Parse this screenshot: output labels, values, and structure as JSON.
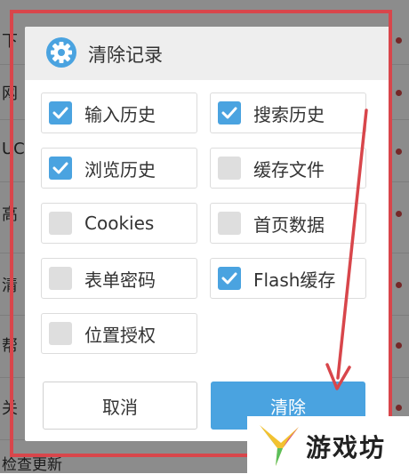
{
  "background": {
    "rows": [
      "下",
      "网",
      "UC",
      "高",
      "清",
      "帮",
      "关"
    ],
    "bottom_text": "检查更新"
  },
  "dialog": {
    "icon": "gear-icon",
    "title": "清除记录",
    "options": [
      {
        "label": "输入历史",
        "checked": true
      },
      {
        "label": "搜索历史",
        "checked": true
      },
      {
        "label": "浏览历史",
        "checked": true
      },
      {
        "label": "缓存文件",
        "checked": false
      },
      {
        "label": "Cookies",
        "checked": false
      },
      {
        "label": "首页数据",
        "checked": false
      },
      {
        "label": "表单密码",
        "checked": false
      },
      {
        "label": "Flash缓存",
        "checked": true
      },
      {
        "label": "位置授权",
        "checked": false
      }
    ],
    "cancel_label": "取消",
    "clear_label": "清除"
  },
  "colors": {
    "accent": "#4aa3e0",
    "annotation": "#d8464b"
  },
  "watermark": {
    "text": "游戏坊",
    "icon": "watermark-logo-icon"
  }
}
